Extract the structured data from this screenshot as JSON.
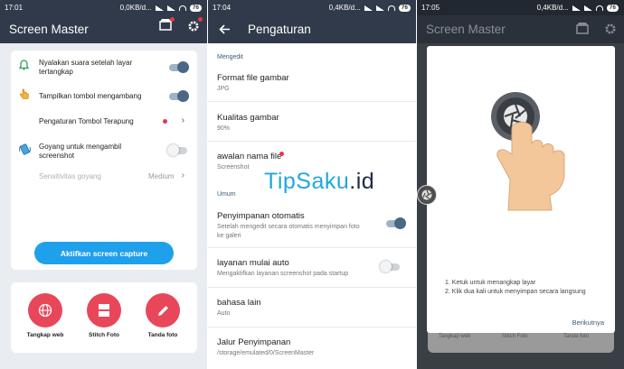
{
  "screen1": {
    "status": {
      "time": "17:01",
      "net": "0,0KB/d...",
      "battery": "76"
    },
    "appbar": {
      "title": "Screen Master"
    },
    "settings": [
      {
        "label": "Nyalakan suara setelah layar tertangkap",
        "toggle": "on"
      },
      {
        "label": "Tampilkan tombol mengambang",
        "toggle": "on"
      },
      {
        "label": "Pengaturan Tombol Terapung"
      },
      {
        "label": "Goyang untuk mengambil screenshot",
        "toggle": "off"
      },
      {
        "label": "Sensitivitas goyang",
        "value": "Medium"
      }
    ],
    "cta_label": "Aktifkan screen capture",
    "modes": [
      {
        "label": "Tangkap web",
        "icon": "globe-icon"
      },
      {
        "label": "Stitch Foto",
        "icon": "stitch-icon"
      },
      {
        "label": "Tanda foto",
        "icon": "pencil-icon"
      }
    ],
    "colors": {
      "appbar": "#313a4a",
      "accent": "#1fa0ea",
      "mode": "#e8475a",
      "toggle_on": "#4a6783"
    }
  },
  "screen2": {
    "status": {
      "time": "17:04",
      "net": "0,4KB/d...",
      "battery": "76"
    },
    "appbar": {
      "title": "Pengaturan"
    },
    "sections": {
      "general": "Mengedit",
      "common": "Umum"
    },
    "items": [
      {
        "title": "Format file gambar",
        "sub": "JPG"
      },
      {
        "title": "Kualitas gambar",
        "sub": "90%"
      },
      {
        "title": "awalan nama file",
        "sub": "Screenshot"
      },
      {
        "title": "Penyimpanan otomatis",
        "sub": "Setelah mengedit secara otomatis menyimpan foto ke galeri",
        "toggle": "on"
      },
      {
        "title": "layanan mulai auto",
        "sub": "Mengaktifkan layanan screenshot pada startup",
        "toggle": "off"
      },
      {
        "title": "bahasa lain",
        "sub": "Auto"
      },
      {
        "title": "Jalur Penyimpanan",
        "sub": "/storage/emulated/0/ScreenMaster"
      }
    ],
    "watermark": {
      "part1": "TipSaku",
      "part2": ".id"
    }
  },
  "screen3": {
    "status": {
      "time": "17:05",
      "net": "0,4KB/d...",
      "battery": "76"
    },
    "appbar": {
      "title": "Screen Master"
    },
    "instructions": [
      "1. Ketuk untuk menangkap layar",
      "2. Klik dua kali untuk menyimpan secara langsung"
    ],
    "next_label": "Berikutnya",
    "behind_labels": [
      "Tangkap web",
      "Stitch Foto",
      "Tanda foto"
    ]
  }
}
